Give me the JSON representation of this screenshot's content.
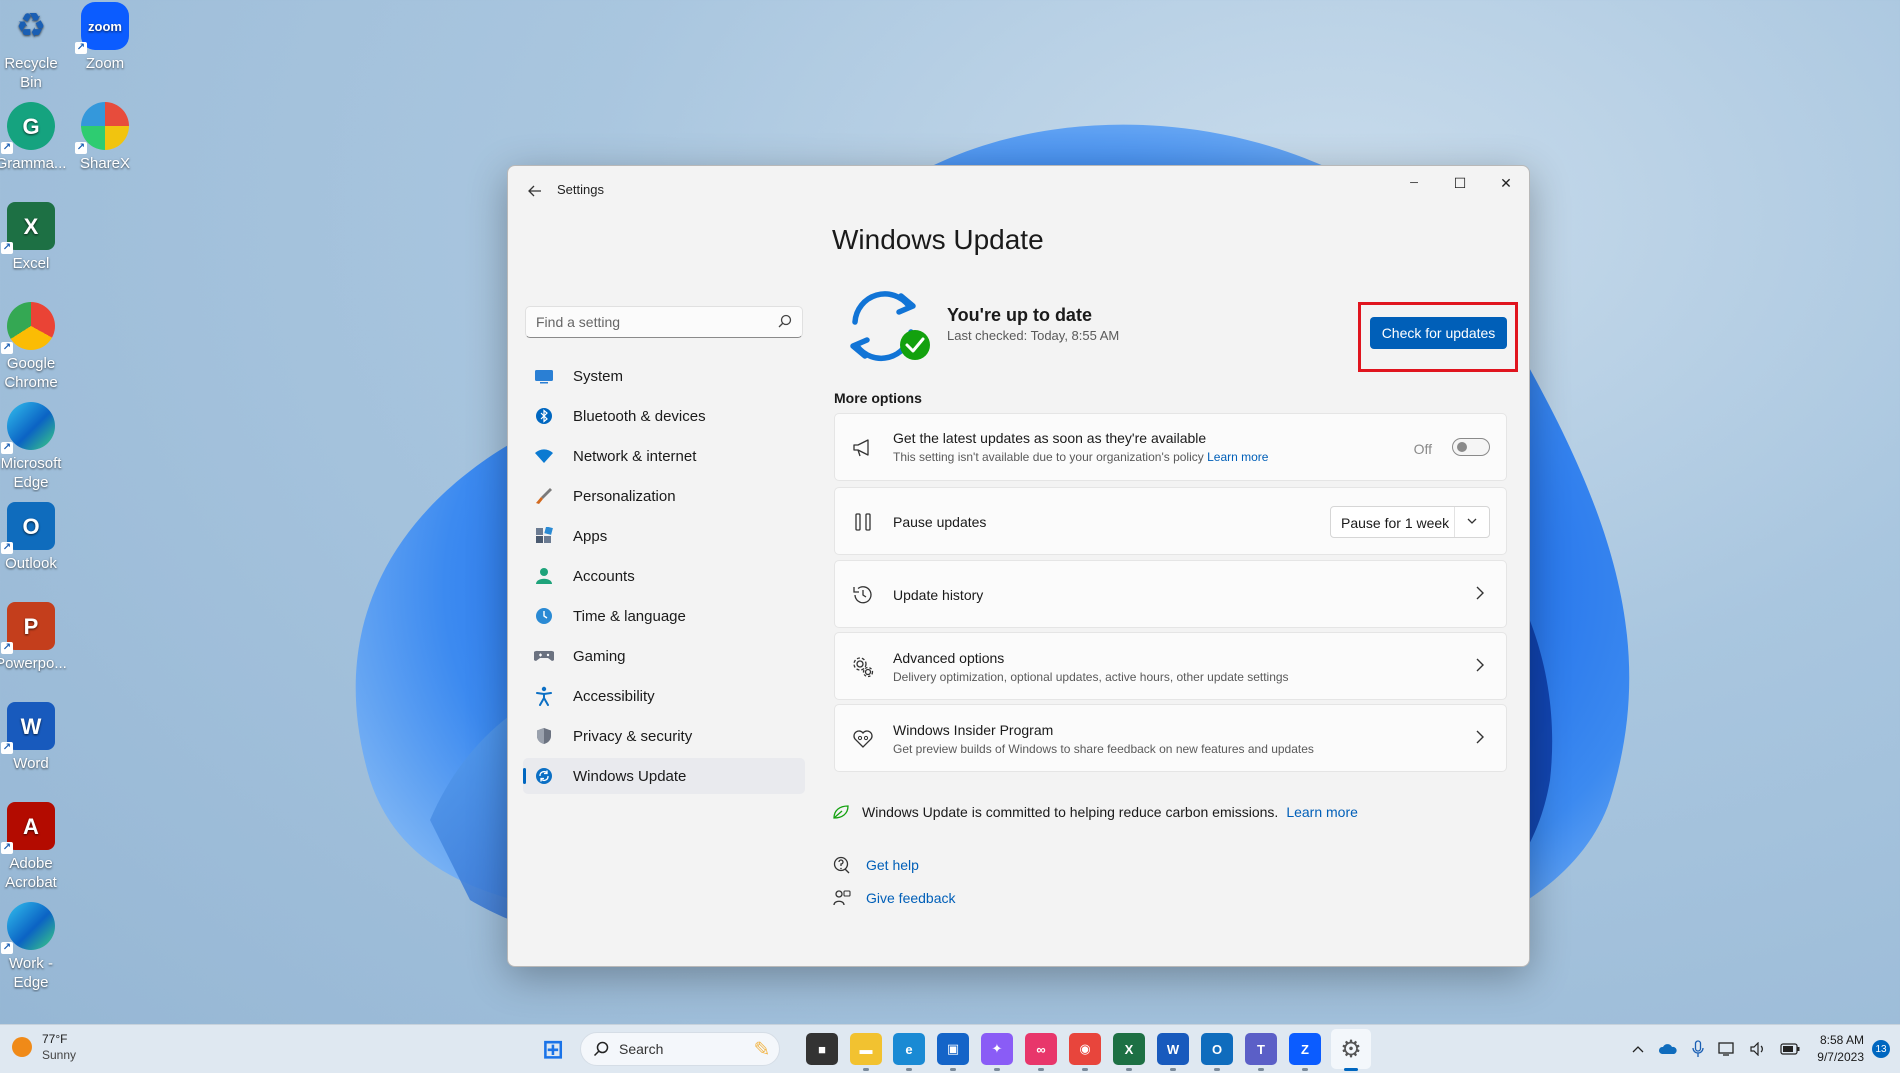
{
  "desktop": {
    "icons": [
      {
        "label": "Recycle Bin",
        "glyph": "♻",
        "color": "#dfe8f1"
      },
      {
        "label": "Zoom",
        "glyph": "zoom",
        "color": "#0b5cff"
      },
      {
        "label": "Gramma...",
        "glyph": "G",
        "color": "#15a37f"
      },
      {
        "label": "ShareX",
        "glyph": "",
        "color": "#2b9de0"
      },
      {
        "label": "Excel",
        "glyph": "X",
        "color": "#1d7044"
      },
      {
        "label": "Google Chrome",
        "glyph": "",
        "color": "#e8eaed"
      },
      {
        "label": "Microsoft Edge",
        "glyph": "",
        "color": "#1a8ad4"
      },
      {
        "label": "Outlook",
        "glyph": "O",
        "color": "#0f6cbd"
      },
      {
        "label": "Powerpo...",
        "glyph": "P",
        "color": "#c43e1c"
      },
      {
        "label": "Word",
        "glyph": "W",
        "color": "#185abd"
      },
      {
        "label": "Adobe Acrobat",
        "glyph": "A",
        "color": "#b30b00"
      },
      {
        "label": "Work - Edge",
        "glyph": "",
        "color": "#1a8ad4"
      }
    ]
  },
  "window": {
    "title": "Settings",
    "controls": {
      "minimize": "─",
      "maximize": "☐",
      "close": "✕"
    }
  },
  "sidebar": {
    "search_placeholder": "Find a setting",
    "items": [
      {
        "label": "System",
        "icon": "system-icon",
        "color": "#2a7fd4"
      },
      {
        "label": "Bluetooth & devices",
        "icon": "bluetooth-icon",
        "color": "#0067c0"
      },
      {
        "label": "Network & internet",
        "icon": "wifi-icon",
        "color": "#0b7ad1"
      },
      {
        "label": "Personalization",
        "icon": "brush-icon",
        "color": "#d2691e"
      },
      {
        "label": "Apps",
        "icon": "apps-icon",
        "color": "#4a5a70"
      },
      {
        "label": "Accounts",
        "icon": "person-icon",
        "color": "#1ea37a"
      },
      {
        "label": "Time & language",
        "icon": "globe-clock-icon",
        "color": "#2a8ad4"
      },
      {
        "label": "Gaming",
        "icon": "gamepad-icon",
        "color": "#6b7280"
      },
      {
        "label": "Accessibility",
        "icon": "accessibility-icon",
        "color": "#0b6fc4"
      },
      {
        "label": "Privacy & security",
        "icon": "shield-icon",
        "color": "#6b7280"
      },
      {
        "label": "Windows Update",
        "icon": "update-icon",
        "color": "#0b6fc4"
      }
    ],
    "active_index": 10
  },
  "main": {
    "title": "Windows Update",
    "status_title": "You're up to date",
    "status_sub": "Last checked: Today, 8:55 AM",
    "check_button": "Check for updates",
    "more_options_label": "More options",
    "latest_updates": {
      "title": "Get the latest updates as soon as they're available",
      "sub": "This setting isn't available due to your organization's policy",
      "link": "Learn more",
      "toggle_label": "Off"
    },
    "pause": {
      "title": "Pause updates",
      "dropdown_value": "Pause for 1 week"
    },
    "history": {
      "title": "Update history"
    },
    "advanced": {
      "title": "Advanced options",
      "sub": "Delivery optimization, optional updates, active hours, other update settings"
    },
    "insider": {
      "title": "Windows Insider Program",
      "sub": "Get preview builds of Windows to share feedback on new features and updates"
    },
    "eco_text": "Windows Update is committed to helping reduce carbon emissions.",
    "eco_link": "Learn more",
    "get_help": "Get help",
    "give_feedback": "Give feedback"
  },
  "taskbar": {
    "weather_temp": "77°F",
    "weather_cond": "Sunny",
    "search_label": "Search",
    "apps": [
      {
        "name": "start-button",
        "glyph": "⊞",
        "color": "#1a73e8"
      },
      {
        "name": "widgets-icon",
        "glyph": "✎",
        "color": "#f2b64a"
      },
      {
        "name": "task-view-icon",
        "glyph": "■",
        "color": "#333333"
      },
      {
        "name": "file-explorer-icon",
        "glyph": "▬",
        "color": "#f2c230"
      },
      {
        "name": "edge-icon",
        "glyph": "e",
        "color": "#1a8ad4"
      },
      {
        "name": "store-icon",
        "glyph": "▣",
        "color": "#1464c8"
      },
      {
        "name": "copilot-icon",
        "glyph": "✦",
        "color": "#8a5cf6"
      },
      {
        "name": "creative-cloud-icon",
        "glyph": "∞",
        "color": "#e8366b"
      },
      {
        "name": "chrome-icon",
        "glyph": "◉",
        "color": "#e8453c"
      },
      {
        "name": "excel-icon",
        "glyph": "X",
        "color": "#1d7044"
      },
      {
        "name": "word-icon",
        "glyph": "W",
        "color": "#185abd"
      },
      {
        "name": "outlook-icon",
        "glyph": "O",
        "color": "#0f6cbd"
      },
      {
        "name": "teams-icon",
        "glyph": "T",
        "color": "#5b5fc7"
      },
      {
        "name": "zoom-icon",
        "glyph": "Z",
        "color": "#0b5cff"
      },
      {
        "name": "settings-icon",
        "glyph": "⚙",
        "color": "#555555"
      }
    ],
    "time": "8:58 AM",
    "date": "9/7/2023",
    "notifications": "13"
  },
  "colors": {
    "accent": "#005fb8",
    "highlight": "#e0141e",
    "success": "#13a10e"
  }
}
